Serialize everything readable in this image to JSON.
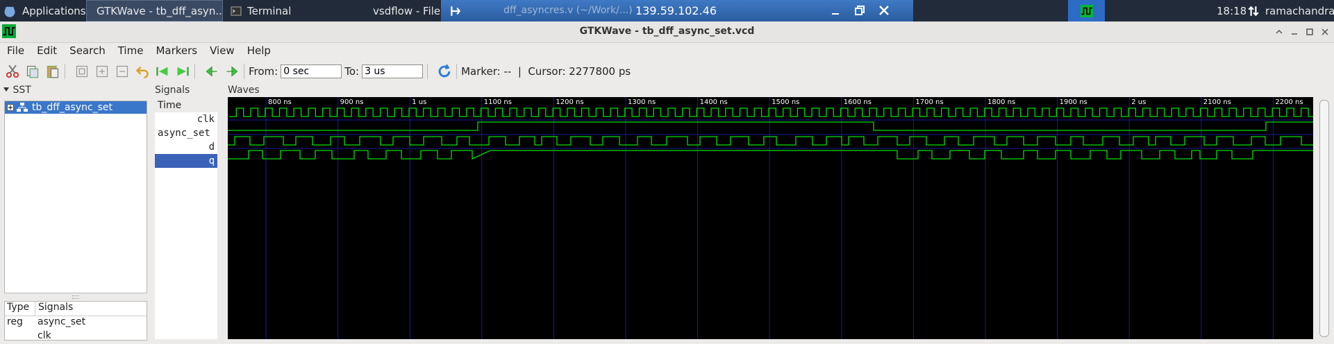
{
  "taskbar": {
    "applications": "Applications",
    "windows": [
      "GTKWave - tb_dff_asyn...",
      "Terminal",
      "vsdflow - File Manager",
      "dff_asyncres.v (~/Work/...)"
    ],
    "remote_ip": "139.59.102.46",
    "clock": "18:18",
    "user": "ramachandran"
  },
  "window": {
    "title": "GTKWave - tb_dff_async_set.vcd"
  },
  "menu": [
    "File",
    "Edit",
    "Search",
    "Time",
    "Markers",
    "View",
    "Help"
  ],
  "toolbar": {
    "from_label": "From:",
    "from_value": "0 sec",
    "to_label": "To:",
    "to_value": "3 us",
    "marker_text": "Marker: --  |  Cursor: 2277800 ps"
  },
  "sst": {
    "label": "SST",
    "tree_item": "tb_dff_async_set",
    "table_headers": [
      "Type",
      "Signals"
    ],
    "table_rows": [
      [
        "reg",
        "async_set"
      ],
      [
        "",
        "clk"
      ]
    ]
  },
  "signals": {
    "label": "Signals",
    "rows": [
      "Time",
      "clk",
      "async_set",
      "d",
      "q"
    ]
  },
  "waves": {
    "label": "Waves",
    "ticks": [
      "800 ns",
      "900 ns",
      "1 us",
      "1100 ns",
      "1200 ns",
      "1300 ns",
      "1400 ns",
      "1500 ns",
      "1600 ns",
      "1700 ns",
      "1800 ns",
      "1900 ns",
      "2 us",
      "2100 ns",
      "2200 ns"
    ],
    "wave_color": "#00e000",
    "grid_color": "#1a1a9a"
  }
}
